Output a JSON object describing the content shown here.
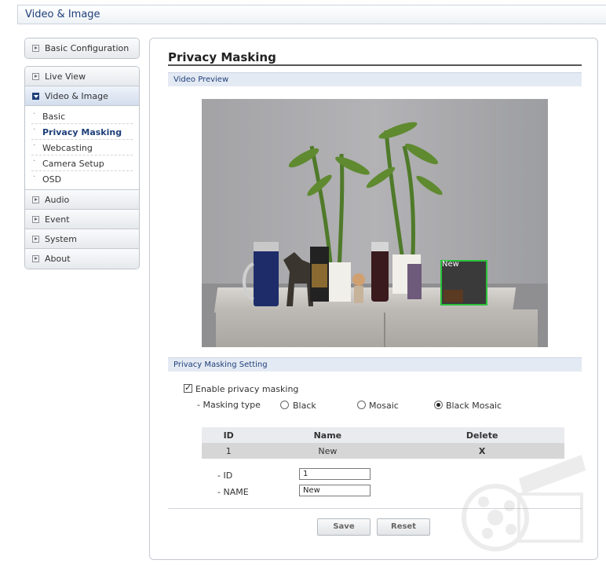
{
  "header": {
    "title": "Video & Image"
  },
  "sidebar": {
    "top": "Basic Configuration",
    "items": [
      {
        "label": "Live View"
      },
      {
        "label": "Video & Image"
      },
      {
        "label": "Audio"
      },
      {
        "label": "Event"
      },
      {
        "label": "System"
      },
      {
        "label": "About"
      }
    ],
    "sub_items": [
      {
        "label": "Basic"
      },
      {
        "label": "Privacy Masking"
      },
      {
        "label": "Webcasting"
      },
      {
        "label": "Camera Setup"
      },
      {
        "label": "OSD"
      }
    ],
    "bullet": "·"
  },
  "main": {
    "title": "Privacy Masking",
    "video_section": "Video Preview",
    "mask_label": "New",
    "setting_section": "Privacy Masking Setting",
    "enable_label": "Enable privacy masking",
    "masking_type_label": "- Masking type",
    "options": [
      "Black",
      "Mosaic",
      "Black Mosaic"
    ],
    "selected_option": "Black Mosaic",
    "table": {
      "headers": [
        "ID",
        "Name",
        "Delete"
      ],
      "rows": [
        {
          "id": "1",
          "name": "New",
          "delete": "X"
        }
      ]
    },
    "id_label": "- ID",
    "id_value": "1",
    "name_label": "- NAME",
    "name_value": "New",
    "save_label": "Save",
    "reset_label": "Reset"
  },
  "colors": {
    "accent": "#1f3f7a",
    "mask_border": "#2bc23a",
    "section_bg": "#e4eaf3"
  }
}
